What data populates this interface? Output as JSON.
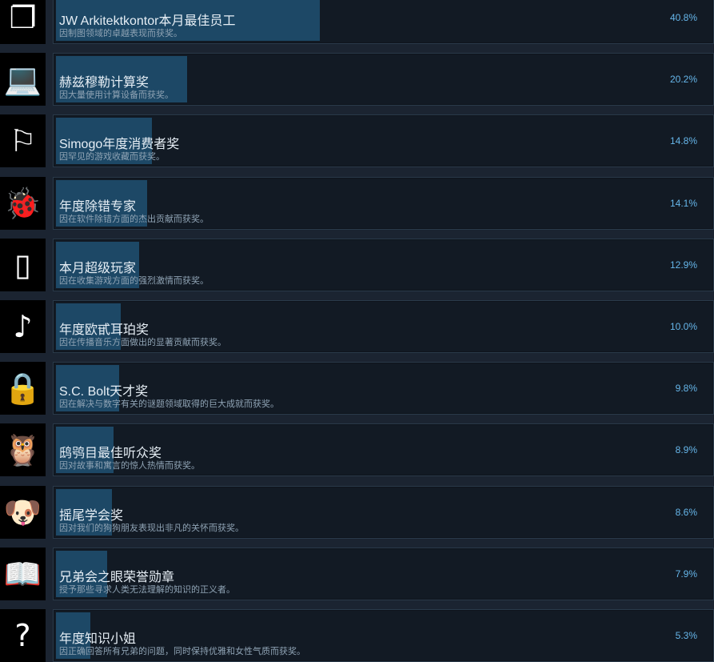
{
  "colors": {
    "fill": "#1d4866",
    "percent": "#66b6ea",
    "background": "#1b2431"
  },
  "achievements": [
    {
      "icon": "folder-icon",
      "glyph": "❐",
      "title": "JW Arkitektkontor本月最佳员工",
      "desc": "因制图领域的卓越表现而获奖。",
      "percent": "40.8%",
      "value": 40.8
    },
    {
      "icon": "computer-icon",
      "glyph": "💻",
      "title": "赫兹穆勒计算奖",
      "desc": "因大量使用计算设备而获奖。",
      "percent": "20.2%",
      "value": 20.2
    },
    {
      "icon": "arcade-sign-icon",
      "glyph": "⚐",
      "title": "Simogo年度消费者奖",
      "desc": "因罕见的游戏收藏而获奖。",
      "percent": "14.8%",
      "value": 14.8
    },
    {
      "icon": "bug-icon",
      "glyph": "🐞",
      "title": "年度除错专家",
      "desc": "因在软件除错方面的杰出贡献而获奖。",
      "percent": "14.1%",
      "value": 14.1
    },
    {
      "icon": "handheld-console-icon",
      "glyph": "▯",
      "title": "本月超级玩家",
      "desc": "因在收集游戏方面的强烈激情而获奖。",
      "percent": "12.9%",
      "value": 12.9
    },
    {
      "icon": "music-note-icon",
      "glyph": "♪",
      "title": "年度欧甙耳珀奖",
      "desc": "因在传播音乐方面做出的显著贡献而获奖。",
      "percent": "10.0%",
      "value": 10.0
    },
    {
      "icon": "padlock-icon",
      "glyph": "🔒",
      "title": "S.C. Bolt天才奖",
      "desc": "因在解决与数字有关的谜题领域取得的巨大成就而获奖。",
      "percent": "9.8%",
      "value": 9.8
    },
    {
      "icon": "owl-icon",
      "glyph": "🦉",
      "title": "鸱鸮目最佳听众奖",
      "desc": "因对故事和寓言的惊人热情而获奖。",
      "percent": "8.9%",
      "value": 8.9
    },
    {
      "icon": "dog-icon",
      "glyph": "🐶",
      "title": "摇尾学会奖",
      "desc": "因对我们的狗狗朋友表现出非凡的关怀而获奖。",
      "percent": "8.6%",
      "value": 8.6
    },
    {
      "icon": "book-icon",
      "glyph": "📖",
      "title": "兄弟会之眼荣誉勋章",
      "desc": "授予那些寻求人类无法理解的知识的正义者。",
      "percent": "7.9%",
      "value": 7.9
    },
    {
      "icon": "question-mark-icon",
      "glyph": "?",
      "title": "年度知识小姐",
      "desc": "因正确回答所有兄弟的问题，同时保持优雅和女性气质而获奖。",
      "percent": "5.3%",
      "value": 5.3
    }
  ]
}
